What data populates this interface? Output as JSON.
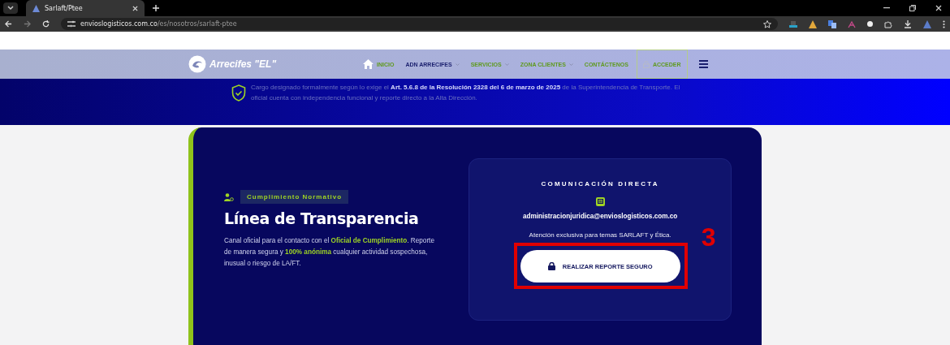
{
  "browser": {
    "tab_title": "Sarlaft/Ptee",
    "url_host": "envioslogisticos.com.co",
    "url_path": "/es/nosotros/sarlaft-ptee"
  },
  "nav": {
    "brand": "Arrecifes \"EL\"",
    "items": [
      {
        "label": "INICIO",
        "selected": false,
        "dropdown": false,
        "home": true
      },
      {
        "label": "ADN ARRECIFES",
        "selected": true,
        "dropdown": true,
        "home": false
      },
      {
        "label": "SERVICIOS",
        "selected": false,
        "dropdown": true,
        "home": false
      },
      {
        "label": "ZONA CLIENTES",
        "selected": false,
        "dropdown": true,
        "home": false
      },
      {
        "label": "CONTÁCTENOS",
        "selected": false,
        "dropdown": false,
        "home": false
      }
    ],
    "login": "ACCEDER"
  },
  "banner": {
    "text": "Cargo designado formalmente según lo exige el **Art. 5.6.8 de la Resolución 2328 del 6 de marzo de 2025** de la Superintendencia de Transporte. El oficial cuenta con independencia funcional y reporte directo a la Alta Dirección."
  },
  "card": {
    "badge": "Cumplimiento Normativo",
    "title": "Línea de Transparencia",
    "description": "Canal oficial para el contacto con el **Oficial de Cumplimiento**. Reporte de manera segura y **100% anónima** cualquier actividad sospechosa, inusual o riesgo de LA/FT.",
    "contact": {
      "heading": "COMUNICACIÓN DIRECTA",
      "email": "administracionjuridica@envioslogisticos.com.co",
      "note": "Atención exclusiva para temas SARLAFT y Ética.",
      "button": "REALIZAR REPORTE SEGURO"
    }
  },
  "annotation": "3"
}
